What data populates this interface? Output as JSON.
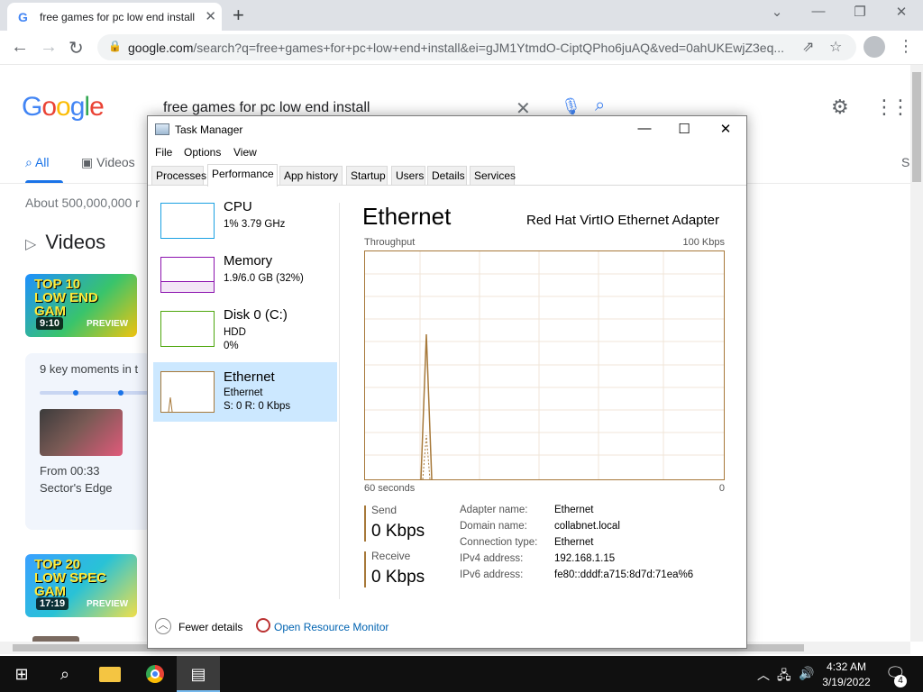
{
  "browser": {
    "tab_title": "free games for pc low end install",
    "tab_favicon": "G",
    "tab_close": "✕",
    "new_tab": "+",
    "url_host": "google.com",
    "url_rest": "/search?q=free+games+for+pc+low+end+install&ei=gJM1YtmdO-CiptQPho6juAQ&ved=0ahUKEwjZ3eq..."
  },
  "google": {
    "logo": [
      "G",
      "o",
      "o",
      "g",
      "l",
      "e"
    ],
    "logo_colors": [
      "#4285f4",
      "#ea4335",
      "#fbbc05",
      "#4285f4",
      "#34a853",
      "#ea4335"
    ],
    "query": "free games for pc low end install",
    "tabs": [
      "All",
      "Videos"
    ],
    "tab_partial": "S",
    "stats": "About 500,000,000 r",
    "videos_heading": "Videos",
    "video1": {
      "title_lines": "TOP 10 LOW END GAM",
      "duration": "9:10",
      "badge": "PREVIEW"
    },
    "key_moments_title": "9 key moments in t",
    "key_moment": {
      "from": "From 00:33",
      "name": "Sector's Edge"
    },
    "video2": {
      "title_lines": "TOP 20 LOW SPEC GAM",
      "duration": "17:19",
      "badge": "PREVIEW"
    }
  },
  "taskmgr": {
    "title": "Task Manager",
    "controls": {
      "minimize": "—",
      "maximize": "☐",
      "close": "✕"
    },
    "menu": [
      "File",
      "Options",
      "View"
    ],
    "tabs": [
      "Processes",
      "Performance",
      "App history",
      "Startup",
      "Users",
      "Details",
      "Services"
    ],
    "active_tab": "Performance",
    "resources": [
      {
        "name": "CPU",
        "line1": "1% 3.79 GHz",
        "line2": "",
        "line3": "",
        "color": "#1ba1e2"
      },
      {
        "name": "Memory",
        "line1": "1.9/6.0 GB (32%)",
        "line2": "",
        "line3": "",
        "color": "#8b12ae"
      },
      {
        "name": "Disk 0 (C:)",
        "line1": "HDD",
        "line2": "0%",
        "line3": "",
        "color": "#4da60c"
      },
      {
        "name": "Ethernet",
        "line1": "Ethernet",
        "line2": "S: 0 R: 0 Kbps",
        "line3": "",
        "color": "#a7793a"
      }
    ],
    "detail": {
      "title": "Ethernet",
      "adapter": "Red Hat VirtIO Ethernet Adapter",
      "throughput_label": "Throughput",
      "throughput_max": "100 Kbps",
      "x_left": "60 seconds",
      "x_right": "0",
      "send_label": "Send",
      "send_value": "0 Kbps",
      "receive_label": "Receive",
      "receive_value": "0 Kbps",
      "properties": [
        {
          "label": "Adapter name:",
          "value": "Ethernet"
        },
        {
          "label": "Domain name:",
          "value": "collabnet.local"
        },
        {
          "label": "Connection type:",
          "value": "Ethernet"
        },
        {
          "label": "IPv4 address:",
          "value": "192.168.1.15"
        },
        {
          "label": "IPv6 address:",
          "value": "fe80::dddf:a715:8d7d:71ea%6"
        }
      ]
    },
    "footer": {
      "fewer_details": "Fewer details",
      "resource_monitor": "Open Resource Monitor"
    }
  },
  "taskbar": {
    "time": "4:32 AM",
    "date": "3/19/2022",
    "notification_count": "4"
  }
}
